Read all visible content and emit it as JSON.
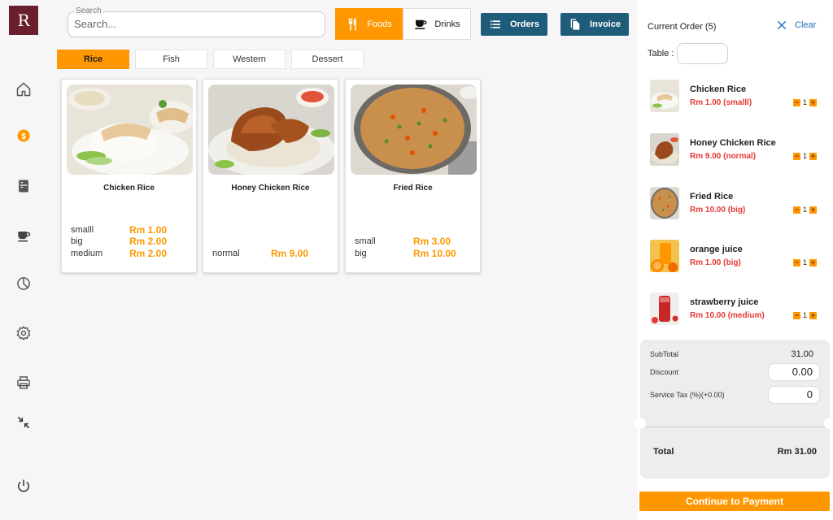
{
  "app": {
    "logo_letter": "R"
  },
  "search": {
    "label": "Search",
    "placeholder": "Search..."
  },
  "toggle": {
    "foods": "Foods",
    "drinks": "Drinks"
  },
  "actions": {
    "orders": "Orders",
    "invoice": "Invoice"
  },
  "categories": [
    {
      "label": "Rice",
      "active": true
    },
    {
      "label": "Fish",
      "active": false
    },
    {
      "label": "Western",
      "active": false
    },
    {
      "label": "Dessert",
      "active": false
    }
  ],
  "products": [
    {
      "name": "Chicken Rice",
      "variants": [
        {
          "label": "smalll",
          "price": "Rm 1.00"
        },
        {
          "label": "big",
          "price": "Rm 2.00"
        },
        {
          "label": "medium",
          "price": "Rm 2.00"
        }
      ]
    },
    {
      "name": "Honey Chicken Rice",
      "variants": [
        {
          "label": "normal",
          "price": "Rm 9.00"
        }
      ]
    },
    {
      "name": "Fried Rice",
      "variants": [
        {
          "label": "small",
          "price": "Rm 3.00"
        },
        {
          "label": "big",
          "price": "Rm 10.00"
        }
      ]
    }
  ],
  "order": {
    "title": "Current Order (5)",
    "clear": "Clear",
    "table_label": "Table :",
    "items": [
      {
        "name": "Chicken Rice",
        "price": "Rm 1.00 (smalll)",
        "qty": "1"
      },
      {
        "name": "Honey Chicken Rice",
        "price": "Rm 9.00 (normal)",
        "qty": "1"
      },
      {
        "name": "Fried Rice",
        "price": "Rm 10.00 (big)",
        "qty": "1"
      },
      {
        "name": "orange juice",
        "price": "Rm 1.00 (big)",
        "qty": "1"
      },
      {
        "name": "strawberry juice",
        "price": "Rm 10.00 (medium)",
        "qty": "1"
      }
    ],
    "subtotal_label": "SubTotal",
    "subtotal": "31.00",
    "discount_label": "Discount",
    "discount": "0.00",
    "tax_label": "Service Tax (%)(+0.00)",
    "tax": "0",
    "total_label": "Total",
    "total": "Rm 31.00",
    "pay": "Continue to Payment"
  },
  "colors": {
    "accent": "#ff9800",
    "dark": "#1f5c7a",
    "price_red": "#e53935",
    "link": "#1f6fb8",
    "brand": "#6b1e2e"
  }
}
